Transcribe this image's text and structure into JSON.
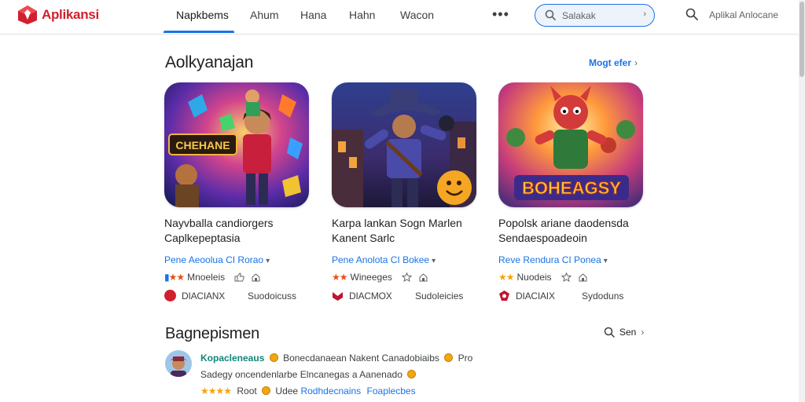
{
  "app": {
    "name": "Aplikansi"
  },
  "nav": {
    "tabs": [
      "Napkbems",
      "Ahum",
      "Hana",
      "Hahn",
      "Wacon"
    ],
    "active_index": 0,
    "more_label": "•••",
    "right_text": "Aplikal Anlocane"
  },
  "search": {
    "value": "Salakak",
    "placeholder": "Salakak"
  },
  "colors": {
    "accent": "#1a73e8",
    "brand": "#d0202e",
    "teal": "#12857a",
    "star": "#e8501b"
  },
  "section1": {
    "title": "Aolkyanajan",
    "see_more": "Mogt efer",
    "cards": [
      {
        "art_text": "CHEHANE",
        "title_line1": "Nayvballa candiorgers",
        "title_line2": "Caplkepeptasia",
        "meta": "Pene  Aeoolua  CI Rorao",
        "rating_text": "Mnoeleis",
        "stars": "★★",
        "foot_code": "DIACIANX",
        "foot_right": "Suodoicuss"
      },
      {
        "art_text": "",
        "title_line1": "Karpa lankan Sogn Marlen",
        "title_line2": "Kanent Sarlc",
        "meta": "Pene  Anolota  CI Bokee",
        "rating_text": "Wineeges",
        "stars": "★★",
        "foot_code": "DIACMOX",
        "foot_right": "Sudoleicies"
      },
      {
        "art_text": "BOHEAGSY",
        "title_line1": "Popolsk ariane daodensda",
        "title_line2": "Sendaespoadeoin",
        "meta": "Reve  Rendura  CI Ponea",
        "rating_text": "Nuodeis",
        "stars": "★★",
        "foot_code": "DIACIAIX",
        "foot_right": "Sydoduns"
      }
    ]
  },
  "section2": {
    "title": "Bagnepismen",
    "search_label": "Sen",
    "review": {
      "name": "Kopacleneaus",
      "line1_rest": "Bonecdanaean  Nakent  Canadobiaibs",
      "line1_end": "Pro",
      "line2": "Sadegy oncendenlarbe Elncanegas a Aanenado",
      "stars": "★★★★",
      "rating_word": "Root",
      "line3_mid": "Udee",
      "line3_link1": "Rodhdecnains",
      "line3_link2": "Foaplecbes"
    }
  }
}
